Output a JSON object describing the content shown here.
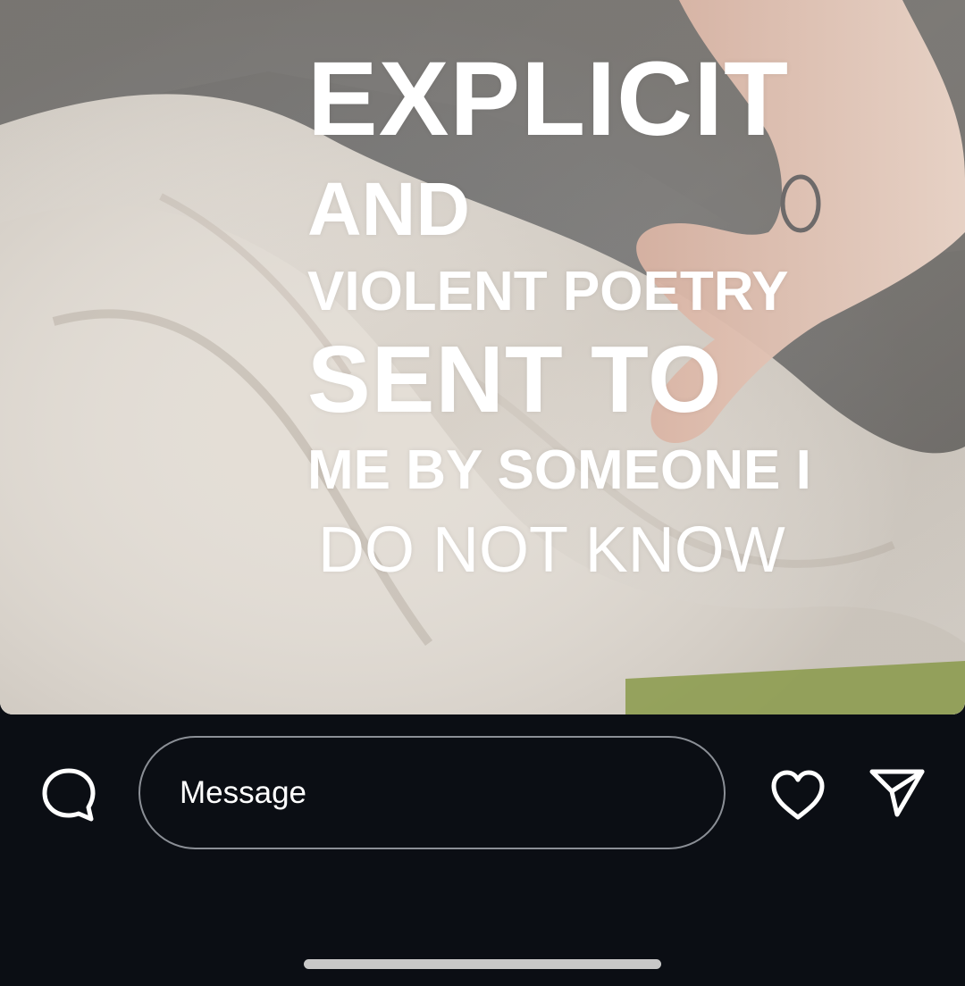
{
  "story": {
    "image_description_icon": "photo-background",
    "text_lines": [
      "EXPLICIT",
      "AND",
      "VIOLENT POETRY",
      "SENT TO",
      "ME BY SOMEONE I",
      "DO NOT KNOW"
    ]
  },
  "reply_bar": {
    "comment_icon": "comment-bubble-icon",
    "message_placeholder": "Message",
    "like_icon": "heart-icon",
    "share_icon": "paper-plane-icon"
  },
  "colors": {
    "background": "#0b0e14",
    "text": "#ffffff",
    "field_border": "#8b8f96"
  }
}
